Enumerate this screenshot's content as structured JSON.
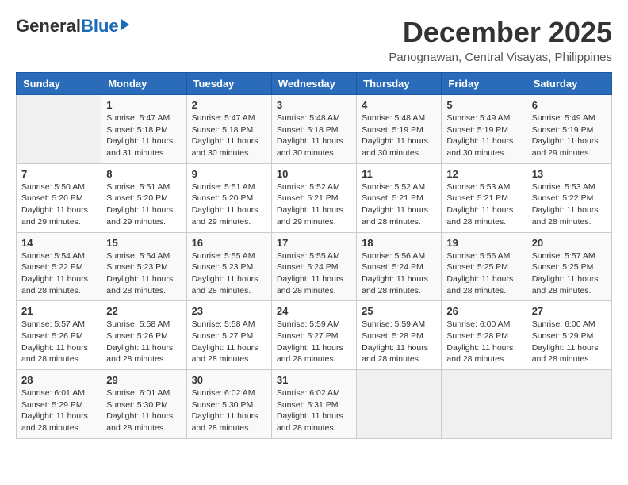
{
  "header": {
    "logo_general": "General",
    "logo_blue": "Blue",
    "month_title": "December 2025",
    "subtitle": "Panognawan, Central Visayas, Philippines"
  },
  "weekdays": [
    "Sunday",
    "Monday",
    "Tuesday",
    "Wednesday",
    "Thursday",
    "Friday",
    "Saturday"
  ],
  "weeks": [
    [
      {
        "day": "",
        "sunrise": "",
        "sunset": "",
        "daylight": ""
      },
      {
        "day": "1",
        "sunrise": "Sunrise: 5:47 AM",
        "sunset": "Sunset: 5:18 PM",
        "daylight": "Daylight: 11 hours and 31 minutes."
      },
      {
        "day": "2",
        "sunrise": "Sunrise: 5:47 AM",
        "sunset": "Sunset: 5:18 PM",
        "daylight": "Daylight: 11 hours and 30 minutes."
      },
      {
        "day": "3",
        "sunrise": "Sunrise: 5:48 AM",
        "sunset": "Sunset: 5:18 PM",
        "daylight": "Daylight: 11 hours and 30 minutes."
      },
      {
        "day": "4",
        "sunrise": "Sunrise: 5:48 AM",
        "sunset": "Sunset: 5:19 PM",
        "daylight": "Daylight: 11 hours and 30 minutes."
      },
      {
        "day": "5",
        "sunrise": "Sunrise: 5:49 AM",
        "sunset": "Sunset: 5:19 PM",
        "daylight": "Daylight: 11 hours and 30 minutes."
      },
      {
        "day": "6",
        "sunrise": "Sunrise: 5:49 AM",
        "sunset": "Sunset: 5:19 PM",
        "daylight": "Daylight: 11 hours and 29 minutes."
      }
    ],
    [
      {
        "day": "7",
        "sunrise": "Sunrise: 5:50 AM",
        "sunset": "Sunset: 5:20 PM",
        "daylight": "Daylight: 11 hours and 29 minutes."
      },
      {
        "day": "8",
        "sunrise": "Sunrise: 5:51 AM",
        "sunset": "Sunset: 5:20 PM",
        "daylight": "Daylight: 11 hours and 29 minutes."
      },
      {
        "day": "9",
        "sunrise": "Sunrise: 5:51 AM",
        "sunset": "Sunset: 5:20 PM",
        "daylight": "Daylight: 11 hours and 29 minutes."
      },
      {
        "day": "10",
        "sunrise": "Sunrise: 5:52 AM",
        "sunset": "Sunset: 5:21 PM",
        "daylight": "Daylight: 11 hours and 29 minutes."
      },
      {
        "day": "11",
        "sunrise": "Sunrise: 5:52 AM",
        "sunset": "Sunset: 5:21 PM",
        "daylight": "Daylight: 11 hours and 28 minutes."
      },
      {
        "day": "12",
        "sunrise": "Sunrise: 5:53 AM",
        "sunset": "Sunset: 5:21 PM",
        "daylight": "Daylight: 11 hours and 28 minutes."
      },
      {
        "day": "13",
        "sunrise": "Sunrise: 5:53 AM",
        "sunset": "Sunset: 5:22 PM",
        "daylight": "Daylight: 11 hours and 28 minutes."
      }
    ],
    [
      {
        "day": "14",
        "sunrise": "Sunrise: 5:54 AM",
        "sunset": "Sunset: 5:22 PM",
        "daylight": "Daylight: 11 hours and 28 minutes."
      },
      {
        "day": "15",
        "sunrise": "Sunrise: 5:54 AM",
        "sunset": "Sunset: 5:23 PM",
        "daylight": "Daylight: 11 hours and 28 minutes."
      },
      {
        "day": "16",
        "sunrise": "Sunrise: 5:55 AM",
        "sunset": "Sunset: 5:23 PM",
        "daylight": "Daylight: 11 hours and 28 minutes."
      },
      {
        "day": "17",
        "sunrise": "Sunrise: 5:55 AM",
        "sunset": "Sunset: 5:24 PM",
        "daylight": "Daylight: 11 hours and 28 minutes."
      },
      {
        "day": "18",
        "sunrise": "Sunrise: 5:56 AM",
        "sunset": "Sunset: 5:24 PM",
        "daylight": "Daylight: 11 hours and 28 minutes."
      },
      {
        "day": "19",
        "sunrise": "Sunrise: 5:56 AM",
        "sunset": "Sunset: 5:25 PM",
        "daylight": "Daylight: 11 hours and 28 minutes."
      },
      {
        "day": "20",
        "sunrise": "Sunrise: 5:57 AM",
        "sunset": "Sunset: 5:25 PM",
        "daylight": "Daylight: 11 hours and 28 minutes."
      }
    ],
    [
      {
        "day": "21",
        "sunrise": "Sunrise: 5:57 AM",
        "sunset": "Sunset: 5:26 PM",
        "daylight": "Daylight: 11 hours and 28 minutes."
      },
      {
        "day": "22",
        "sunrise": "Sunrise: 5:58 AM",
        "sunset": "Sunset: 5:26 PM",
        "daylight": "Daylight: 11 hours and 28 minutes."
      },
      {
        "day": "23",
        "sunrise": "Sunrise: 5:58 AM",
        "sunset": "Sunset: 5:27 PM",
        "daylight": "Daylight: 11 hours and 28 minutes."
      },
      {
        "day": "24",
        "sunrise": "Sunrise: 5:59 AM",
        "sunset": "Sunset: 5:27 PM",
        "daylight": "Daylight: 11 hours and 28 minutes."
      },
      {
        "day": "25",
        "sunrise": "Sunrise: 5:59 AM",
        "sunset": "Sunset: 5:28 PM",
        "daylight": "Daylight: 11 hours and 28 minutes."
      },
      {
        "day": "26",
        "sunrise": "Sunrise: 6:00 AM",
        "sunset": "Sunset: 5:28 PM",
        "daylight": "Daylight: 11 hours and 28 minutes."
      },
      {
        "day": "27",
        "sunrise": "Sunrise: 6:00 AM",
        "sunset": "Sunset: 5:29 PM",
        "daylight": "Daylight: 11 hours and 28 minutes."
      }
    ],
    [
      {
        "day": "28",
        "sunrise": "Sunrise: 6:01 AM",
        "sunset": "Sunset: 5:29 PM",
        "daylight": "Daylight: 11 hours and 28 minutes."
      },
      {
        "day": "29",
        "sunrise": "Sunrise: 6:01 AM",
        "sunset": "Sunset: 5:30 PM",
        "daylight": "Daylight: 11 hours and 28 minutes."
      },
      {
        "day": "30",
        "sunrise": "Sunrise: 6:02 AM",
        "sunset": "Sunset: 5:30 PM",
        "daylight": "Daylight: 11 hours and 28 minutes."
      },
      {
        "day": "31",
        "sunrise": "Sunrise: 6:02 AM",
        "sunset": "Sunset: 5:31 PM",
        "daylight": "Daylight: 11 hours and 28 minutes."
      },
      {
        "day": "",
        "sunrise": "",
        "sunset": "",
        "daylight": ""
      },
      {
        "day": "",
        "sunrise": "",
        "sunset": "",
        "daylight": ""
      },
      {
        "day": "",
        "sunrise": "",
        "sunset": "",
        "daylight": ""
      }
    ]
  ]
}
